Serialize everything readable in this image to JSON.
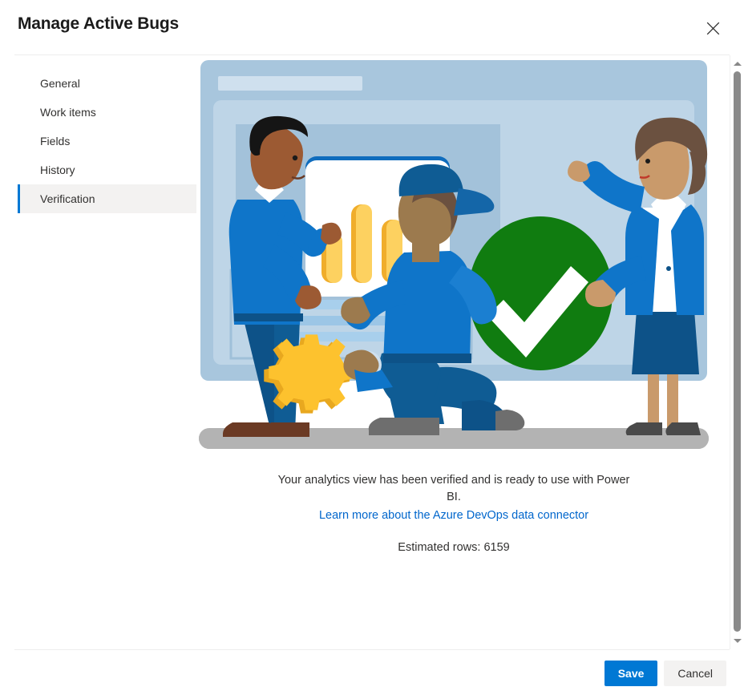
{
  "dialog": {
    "title": "Manage Active Bugs",
    "close_label": "Close",
    "close_icon": "close-icon"
  },
  "sidebar": {
    "items": [
      {
        "label": "General",
        "selected": false
      },
      {
        "label": "Work items",
        "selected": false
      },
      {
        "label": "Fields",
        "selected": false
      },
      {
        "label": "History",
        "selected": false
      },
      {
        "label": "Verification",
        "selected": true
      }
    ]
  },
  "content": {
    "illustration": {
      "name": "verification-success-illustration",
      "description": "Three people in front of a dashboard with a large green check mark",
      "elements": [
        "browser-panel",
        "bar-chart-card",
        "green-check-circle",
        "person-standing-left",
        "person-kneeling-center",
        "person-standing-right",
        "gear",
        "floor"
      ],
      "colors": {
        "panel_outer": "#a8c6dd",
        "panel_title_bar": "#cfe0ee",
        "panel_inner": "#bed5e7",
        "panel_inner_dark": "#a3c2da",
        "card_white": "#ffffff",
        "card_top_border": "#0f6cbd",
        "bar_gold": "#fcc433",
        "bar_gold_light": "#fdd160",
        "check_green": "#107c10",
        "check_white": "#ffffff",
        "shirt_blue": "#0f75c9",
        "pants_blue": "#0f5c94",
        "skin_dark": "#9c5a33",
        "skin_light": "#c99a6b",
        "hair_black": "#151515",
        "hair_brown": "#6b5140",
        "shoe_brown": "#6b3a24",
        "shoe_gray": "#6e6e6e",
        "floor_gray": "#b3b3b3"
      },
      "bar_values": [
        38,
        62,
        46,
        78
      ]
    },
    "caption_line1": "Your analytics view has been verified and is ready to use with Power BI.",
    "caption_link": "Learn more about the Azure DevOps data connector",
    "estimated_rows": "Estimated rows: 6159"
  },
  "scrollbar": {
    "up_icon": "chevron-up-icon",
    "down_icon": "chevron-down-icon"
  },
  "footer": {
    "save_label": "Save",
    "cancel_label": "Cancel"
  },
  "theme": {
    "accent": "#0078d4",
    "link": "#0066cc",
    "selected_bg": "#f3f2f1",
    "divider": "#ededed"
  }
}
